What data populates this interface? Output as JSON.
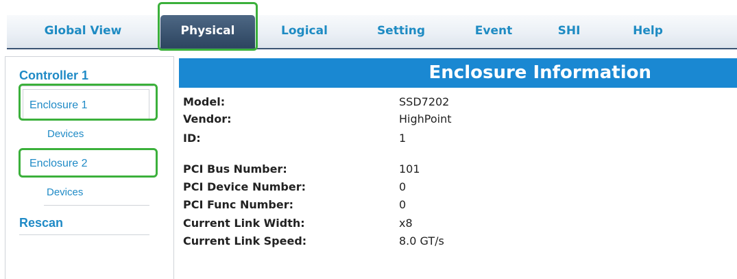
{
  "nav": {
    "tabs": [
      {
        "label": "Global View"
      },
      {
        "label": "Physical",
        "active": true
      },
      {
        "label": "Logical"
      },
      {
        "label": "Setting"
      },
      {
        "label": "Event"
      },
      {
        "label": "SHI"
      },
      {
        "label": "Help"
      }
    ]
  },
  "sidebar": {
    "controller": "Controller 1",
    "enclosure1": "Enclosure 1",
    "devices1": "Devices",
    "enclosure2": "Enclosure 2",
    "devices2": "Devices",
    "rescan": "Rescan"
  },
  "main": {
    "title": "Enclosure Information",
    "fields": [
      {
        "label": "Model:",
        "value": "SSD7202"
      },
      {
        "label": "Vendor:",
        "value": "HighPoint"
      },
      {
        "label": "ID:",
        "value": "1"
      },
      {
        "label": "PCI Bus Number:",
        "value": "101"
      },
      {
        "label": "PCI Device Number:",
        "value": "0"
      },
      {
        "label": "PCI Func Number:",
        "value": "0"
      },
      {
        "label": "Current Link Width:",
        "value": "x8"
      },
      {
        "label": "Current Link Speed:",
        "value": "8.0 GT/s"
      }
    ]
  },
  "colors": {
    "accent_blue": "#1a88d2",
    "link_blue": "#1f8ac6",
    "active_tab": "#2d4560",
    "highlight_green": "#3bb03b"
  }
}
